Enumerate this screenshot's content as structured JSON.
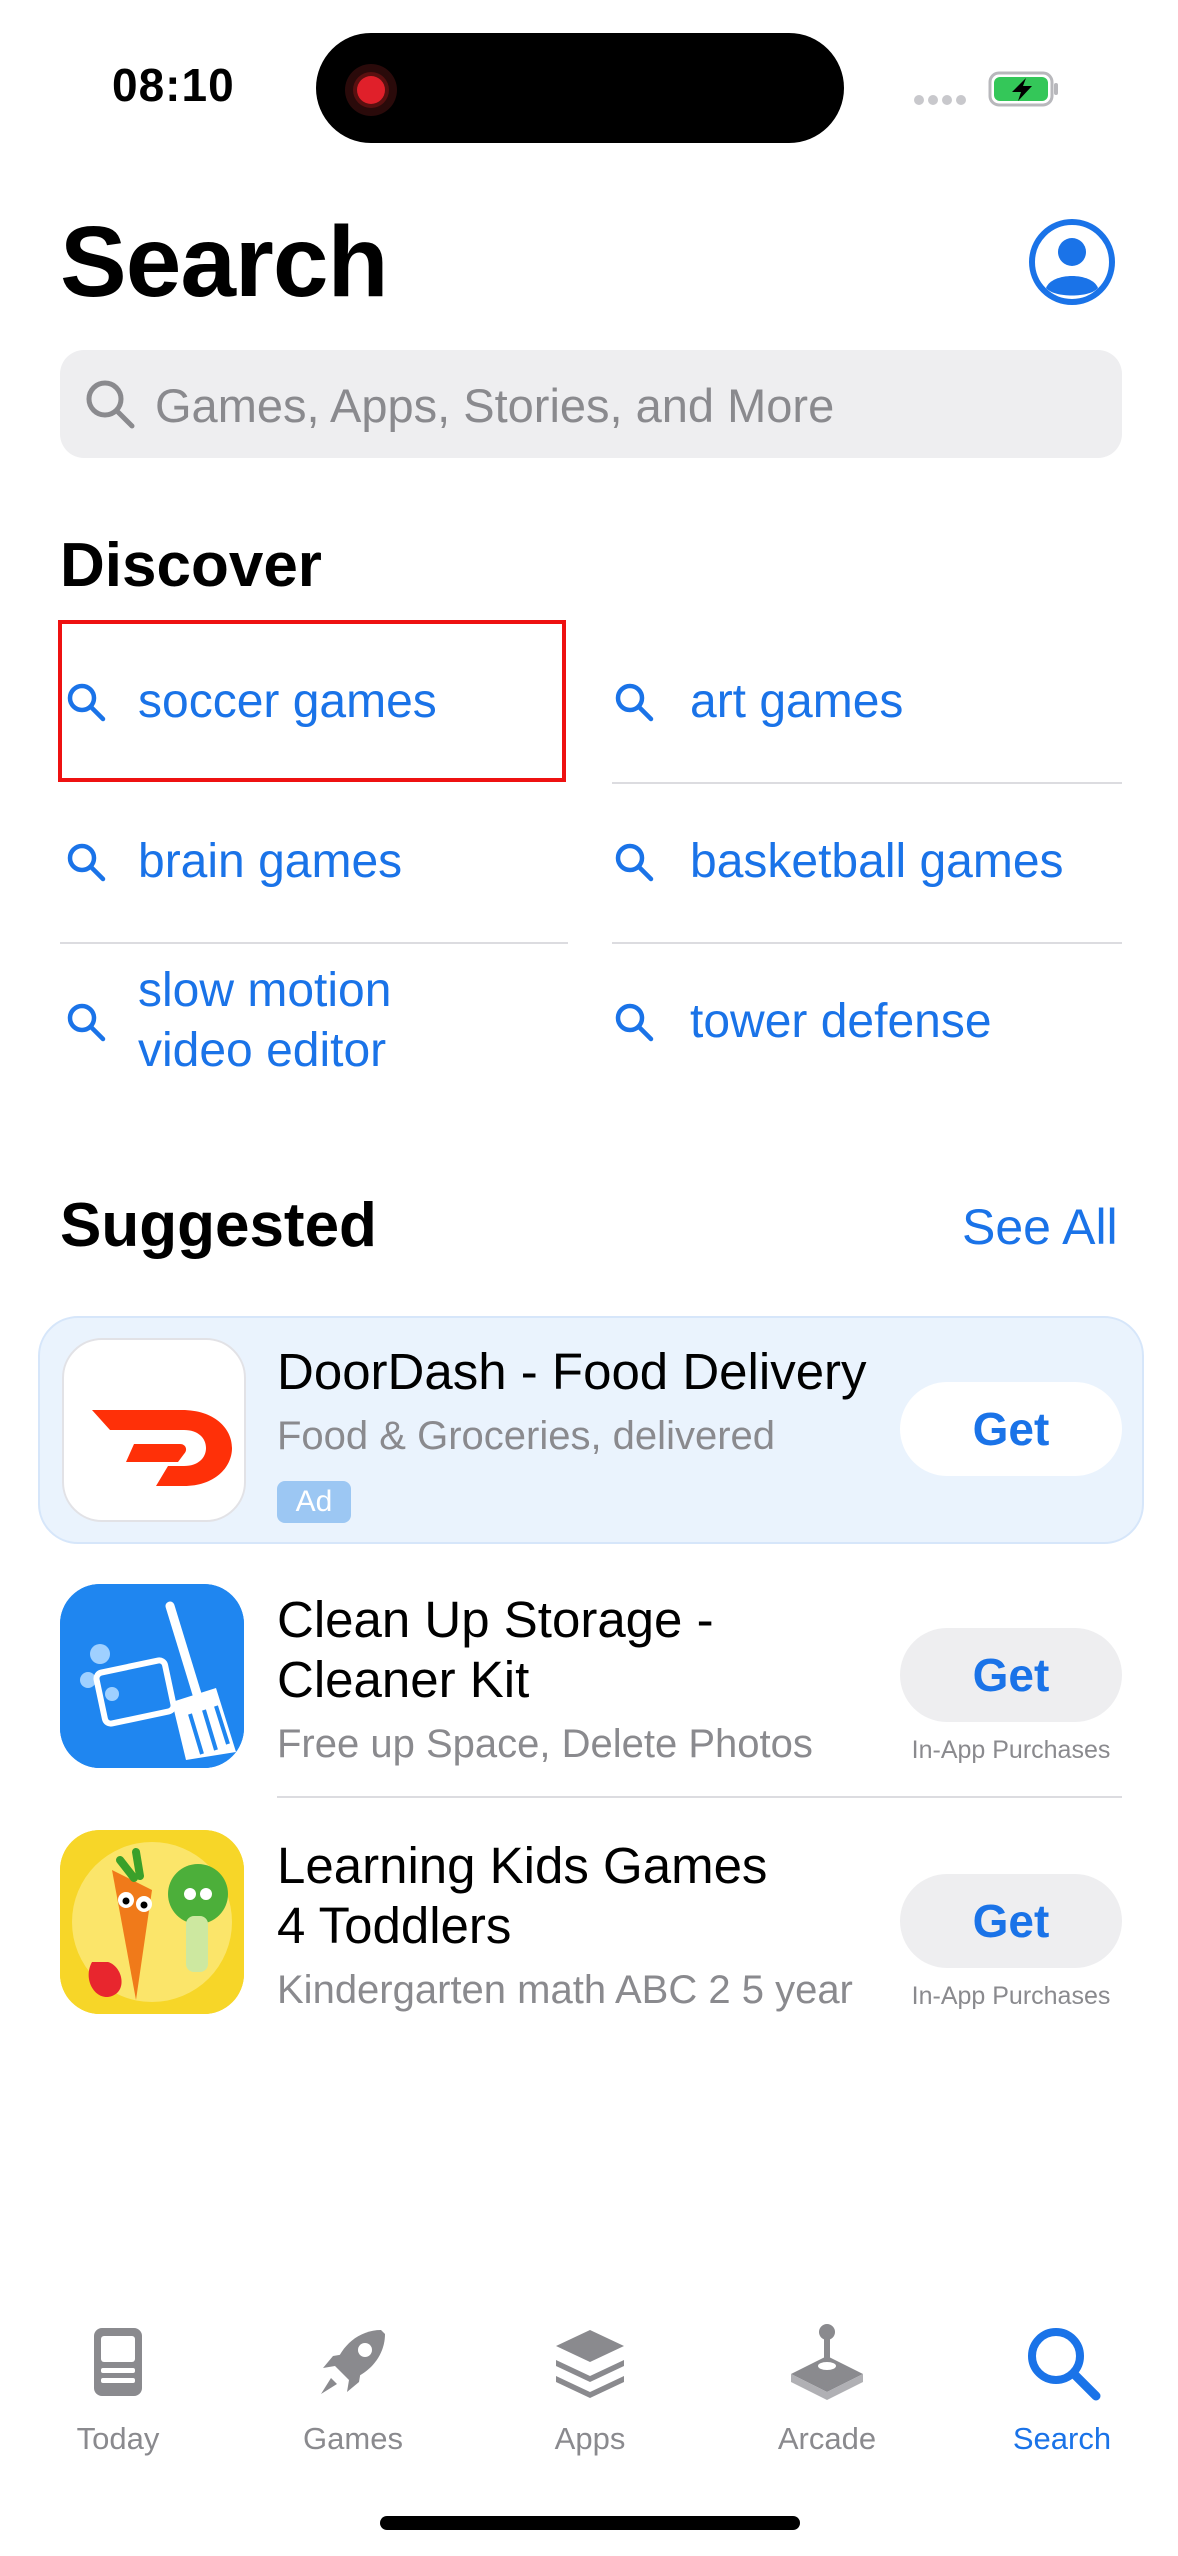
{
  "status_bar": {
    "time": "08:10"
  },
  "header": {
    "title": "Search",
    "account_icon": "person-circle-icon"
  },
  "search": {
    "placeholder": "Games, Apps, Stories, and More",
    "icon": "magnifier-icon"
  },
  "discover": {
    "heading": "Discover",
    "items": [
      {
        "label": "soccer games"
      },
      {
        "label": "art games"
      },
      {
        "label": "brain games"
      },
      {
        "label": "basketball games"
      },
      {
        "label_line1": "slow motion",
        "label_line2": "video editor"
      },
      {
        "label": "tower defense"
      }
    ]
  },
  "suggested": {
    "heading": "Suggested",
    "see_all": "See All",
    "apps": [
      {
        "name": "DoorDash - Food Delivery",
        "subtitle": "Food & Groceries, delivered",
        "badge": "Ad",
        "button": "Get",
        "icon": "doordash-logo-icon"
      },
      {
        "name_line1": "Clean Up Storage -",
        "name_line2": "Cleaner Kit",
        "subtitle": "Free up Space, Delete Photos",
        "button": "Get",
        "note": "In-App Purchases",
        "icon": "broom-cleaner-icon"
      },
      {
        "name_line1": "Learning Kids Games",
        "name_line2": "4 Toddlers",
        "subtitle": "Kindergarten math ABC 2 5 year",
        "button": "Get",
        "note": "In-App Purchases",
        "icon": "vegetables-characters-icon"
      }
    ]
  },
  "tabbar": {
    "items": [
      {
        "label": "Today",
        "icon": "today-icon"
      },
      {
        "label": "Games",
        "icon": "rocket-icon"
      },
      {
        "label": "Apps",
        "icon": "layers-icon"
      },
      {
        "label": "Arcade",
        "icon": "joystick-icon"
      },
      {
        "label": "Search",
        "icon": "search-icon",
        "active": true
      }
    ]
  },
  "colors": {
    "accent": "#1a73e8",
    "highlight_box": "#e11111",
    "ad_card_bg": "#eaf3fd"
  }
}
